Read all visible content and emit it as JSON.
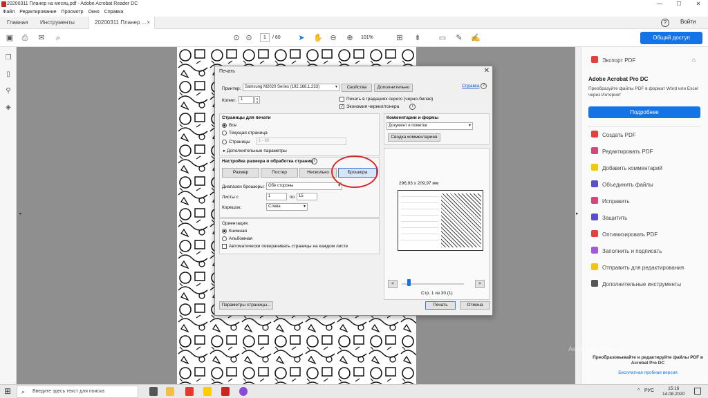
{
  "window": {
    "title": "20200311 Планер на месяц.pdf - Adobe Acrobat Reader DC",
    "min": "—",
    "max": "☐",
    "close": "✕"
  },
  "menu": [
    "Файл",
    "Редактирование",
    "Просмотр",
    "Окно",
    "Справка"
  ],
  "tabs": {
    "home": "Главная",
    "tools": "Инструменты",
    "doc": "20200311 Планер ...",
    "doc_close": "×",
    "help": "?",
    "signin": "Войти"
  },
  "toolbar": {
    "page_current": "1",
    "page_total": "/ 60",
    "zoom": "101%",
    "share": "Общий доступ"
  },
  "right_panel": {
    "export": "Экспорт PDF",
    "product": "Adobe Acrobat Pro DC",
    "desc": "Преобразуйте файлы PDF в формат Word или Excel через Интернет",
    "more_btn": "Подробнее",
    "tools": [
      {
        "label": "Создать PDF",
        "color": "#e0433b"
      },
      {
        "label": "Редактировать PDF",
        "color": "#d9457a"
      },
      {
        "label": "Добавить комментарий",
        "color": "#f2c511"
      },
      {
        "label": "Объединить файлы",
        "color": "#5a4fcf"
      },
      {
        "label": "Исправить",
        "color": "#d9457a"
      },
      {
        "label": "Защитить",
        "color": "#5a4fcf"
      },
      {
        "label": "Оптимизировать PDF",
        "color": "#e0433b"
      },
      {
        "label": "Заполнить и подписать",
        "color": "#a35ad8"
      },
      {
        "label": "Отправить для редактирования",
        "color": "#f2c511"
      },
      {
        "label": "Дополнительные инструменты",
        "color": "#555555"
      }
    ],
    "promo": "Преобразовывайте и редактируйте файлы PDF в Acrobat Pro DC",
    "trial": "Бесплатная пробная версия"
  },
  "dialog": {
    "title": "Печать",
    "printer_label": "Принтер:",
    "printer_value": "Samsung M2020 Series (192.168.1.233)",
    "properties": "Свойства",
    "advanced": "Дополнительно",
    "help": "Справка",
    "copies_label": "Копии:",
    "copies_value": "1",
    "grayscale": "Печать в градациях серого (черно-белая)",
    "ink_save": "Экономия чернил/тонера",
    "pages_title": "Страницы для печати",
    "all": "Все",
    "current": "Текущая страница",
    "pages": "Страницы",
    "pages_value": "1 - 60",
    "more_opts": "Дополнительные параметры",
    "size_title": "Настройка размера и обработка страниц",
    "size": "Размер",
    "poster": "Постер",
    "multiple": "Несколько",
    "booklet": "Брошюра",
    "booklet_range_label": "Диапазон брошюры:",
    "booklet_range_value": "Обе стороны",
    "sheets_from": "Листы с",
    "sheets_from_value": "1",
    "sheets_to": "по",
    "sheets_to_value": "15",
    "binding_label": "Корешок:",
    "binding_value": "Слева",
    "orientation_title": "Ориентация:",
    "portrait": "Книжная",
    "landscape": "Альбомная",
    "auto_rotate": "Автоматически поворачивать страницы на каждом листе",
    "comments_title": "Комментарии и формы",
    "comments_value": "Документ и пометки",
    "summarize": "Сводка комментариев",
    "paper_size": "296,93 x 209,97 мм",
    "prev": "<",
    "next": ">",
    "page_info": "Стр. 1 из 30 (1)",
    "page_setup": "Параметры страницы...",
    "print": "Печать",
    "cancel": "Отмена"
  },
  "taskbar": {
    "search_placeholder": "Введите здесь текст для поиска",
    "lang": "РУС",
    "time": "15:16",
    "date": "14.08.2020"
  },
  "watermark": "Активация Windows"
}
